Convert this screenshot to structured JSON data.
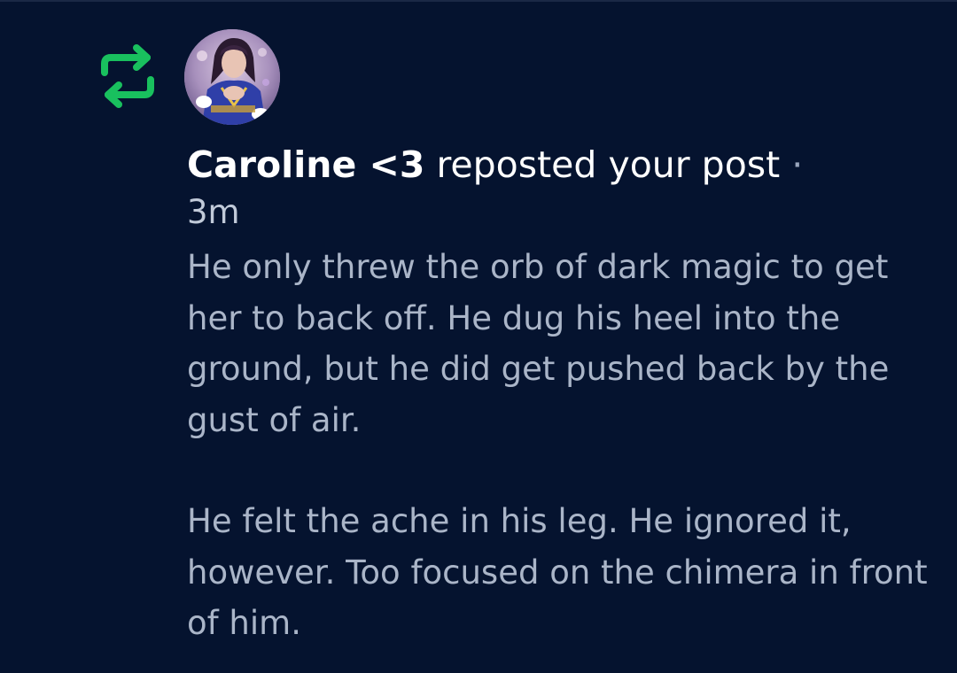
{
  "notification": {
    "username": "Caroline <3",
    "action_text": "reposted your post",
    "separator": "·",
    "time_ago": "3m",
    "icon": "repost-icon",
    "avatar": "user-avatar",
    "accent_color": "#1db954",
    "post_paragraphs": [
      "He only threw the orb of dark magic to get her to back off. He dug his heel into the ground, but he did get pushed back by the gust of air.",
      "He felt the ache in his leg. He ignored it, however. Too focused on the chimera in front of him."
    ]
  }
}
